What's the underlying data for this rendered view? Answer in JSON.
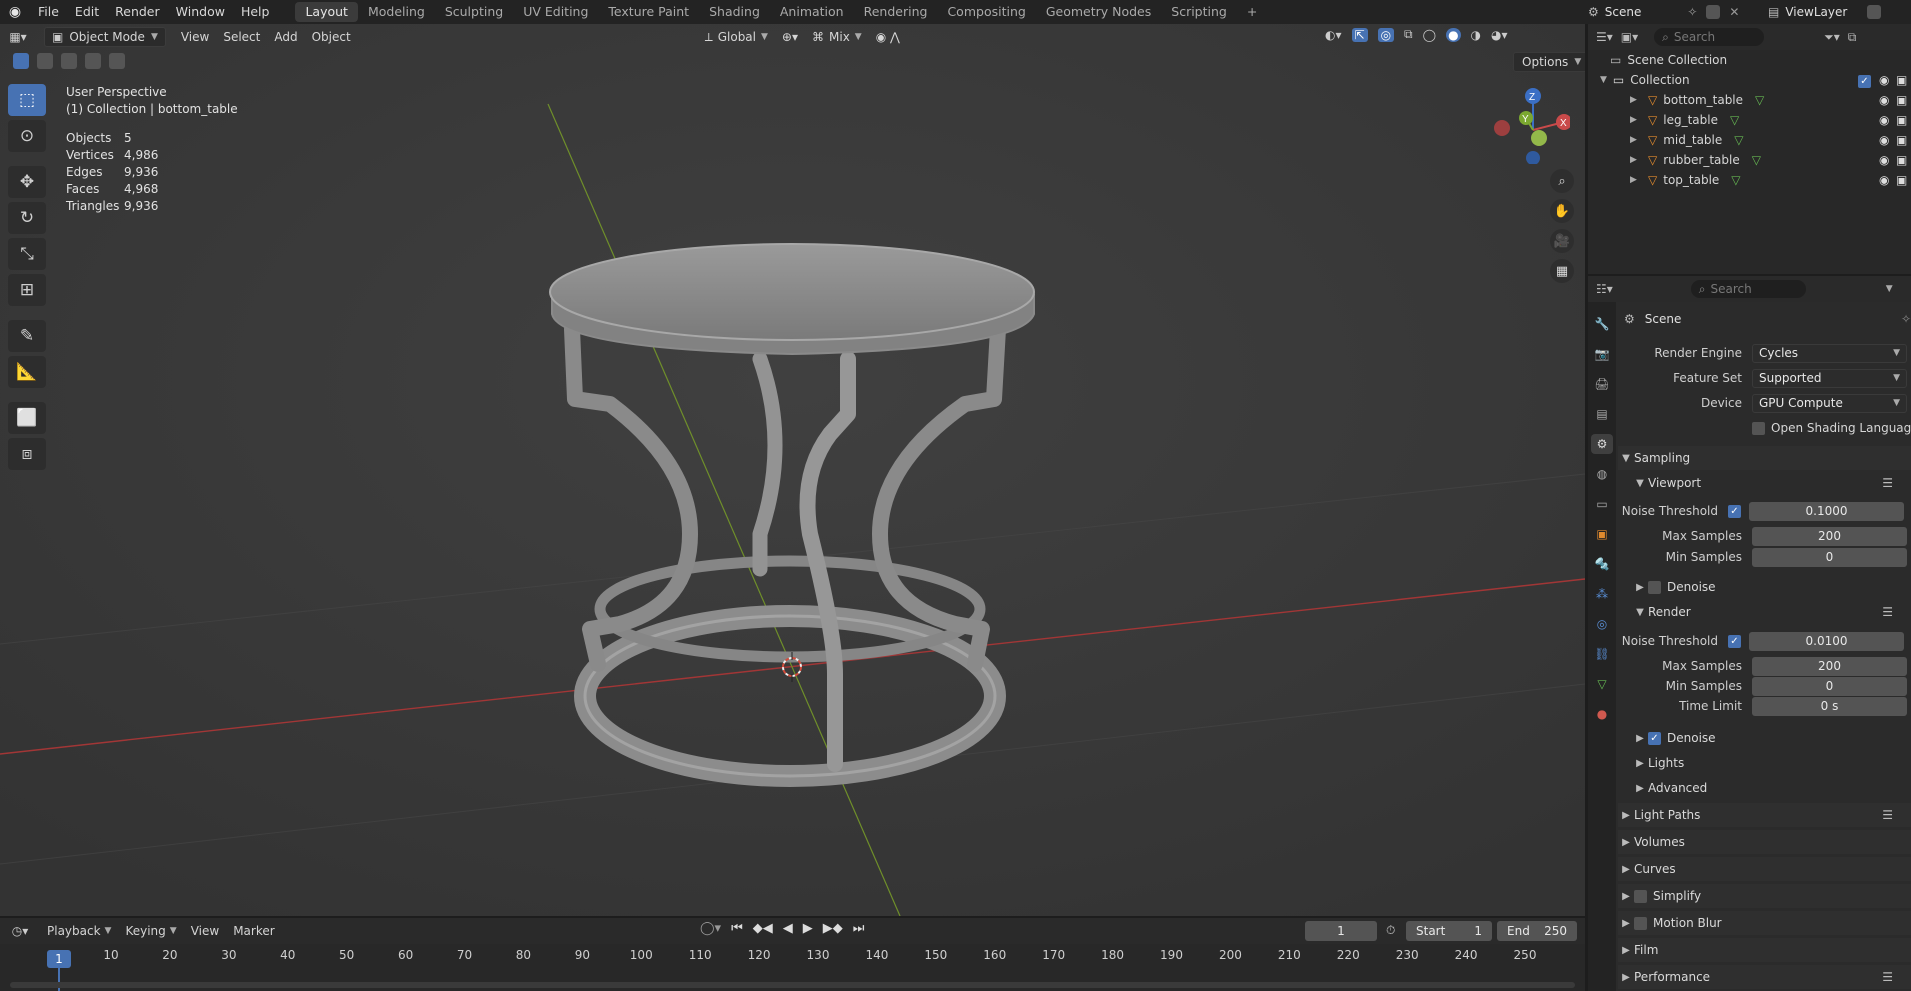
{
  "topbar": {
    "menus": [
      "File",
      "Edit",
      "Render",
      "Window",
      "Help"
    ],
    "workspaces": [
      "Layout",
      "Modeling",
      "Sculpting",
      "UV Editing",
      "Texture Paint",
      "Shading",
      "Animation",
      "Rendering",
      "Compositing",
      "Geometry Nodes",
      "Scripting"
    ],
    "active_workspace": "Layout",
    "add_tab": "+",
    "scene": "Scene",
    "view_layer": "ViewLayer"
  },
  "viewport_header": {
    "mode": "Object Mode",
    "menus": [
      "View",
      "Select",
      "Add",
      "Object"
    ],
    "orientation": "Global",
    "snap": "Mix",
    "options": "Options"
  },
  "viewport": {
    "title": "User Perspective",
    "subtitle": "(1) Collection | bottom_table",
    "stats": [
      {
        "label": "Objects",
        "value": "5"
      },
      {
        "label": "Vertices",
        "value": "4,986"
      },
      {
        "label": "Edges",
        "value": "9,936"
      },
      {
        "label": "Faces",
        "value": "4,968"
      },
      {
        "label": "Triangles",
        "value": "9,936"
      }
    ],
    "gizmo": {
      "z": "Z",
      "y": "Y",
      "x": "X"
    }
  },
  "outliner": {
    "search_placeholder": "Search",
    "scene_collection": "Scene Collection",
    "collection": "Collection",
    "objects": [
      "bottom_table",
      "leg_table",
      "mid_table",
      "rubber_table",
      "top_table"
    ]
  },
  "properties": {
    "search_placeholder": "Search",
    "context": "Scene",
    "render_engine_label": "Render Engine",
    "render_engine": "Cycles",
    "feature_set_label": "Feature Set",
    "feature_set": "Supported",
    "device_label": "Device",
    "device": "GPU Compute",
    "osl": "Open Shading Language",
    "sampling": "Sampling",
    "viewport": "Viewport",
    "noise_threshold_label": "Noise Threshold",
    "vp_noise_threshold": "0.1000",
    "max_samples_label": "Max Samples",
    "vp_max_samples": "200",
    "min_samples_label": "Min Samples",
    "vp_min_samples": "0",
    "denoise": "Denoise",
    "render": "Render",
    "r_noise_threshold": "0.0100",
    "r_max_samples": "200",
    "r_min_samples": "0",
    "time_limit_label": "Time Limit",
    "r_time_limit": "0 s",
    "lights": "Lights",
    "advanced": "Advanced",
    "light_paths": "Light Paths",
    "volumes": "Volumes",
    "curves": "Curves",
    "simplify": "Simplify",
    "motion_blur": "Motion Blur",
    "film": "Film",
    "performance": "Performance"
  },
  "timeline": {
    "menus": [
      "Playback",
      "Keying",
      "View",
      "Marker"
    ],
    "current_frame": "1",
    "start_label": "Start",
    "start": "1",
    "end_label": "End",
    "end": "250",
    "ticks": [
      "1",
      "10",
      "20",
      "30",
      "40",
      "50",
      "60",
      "70",
      "80",
      "90",
      "100",
      "110",
      "120",
      "130",
      "140",
      "150",
      "160",
      "170",
      "180",
      "190",
      "200",
      "210",
      "220",
      "230",
      "240",
      "250"
    ]
  },
  "colors": {
    "accent": "#4772b3",
    "x_axis": "#c43c3c",
    "y_axis": "#7a9a2c",
    "mesh": "#8a8a8a"
  }
}
